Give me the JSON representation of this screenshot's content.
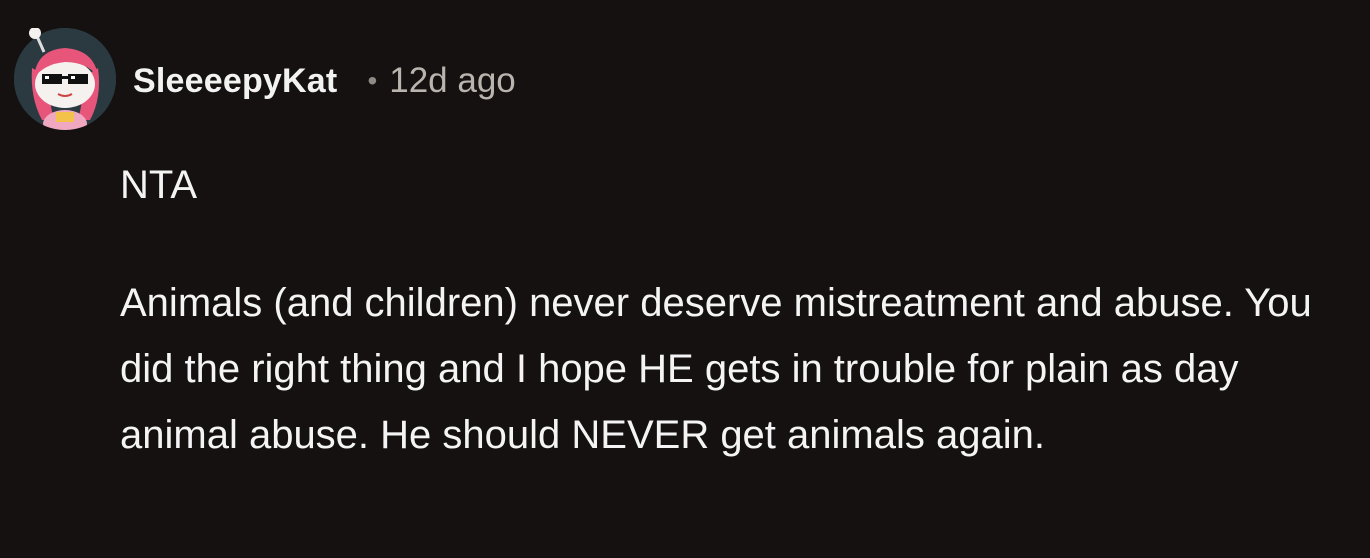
{
  "comment": {
    "username": "SleeeepyKat",
    "separator": "•",
    "timestamp": "12d ago",
    "paragraphs": [
      "NTA",
      "Animals (and children) never deserve mistreatment and abuse. You did the right thing and I hope HE gets in trouble for plain as day animal abuse. He should NEVER get animals again."
    ]
  },
  "colors": {
    "background": "#141110",
    "text": "#f4f4f4",
    "muted": "#b9b4ae",
    "avatar_hair": "#e8557a"
  },
  "icons": {
    "avatar": "snoo-avatar-pink-hair-sunglasses"
  }
}
